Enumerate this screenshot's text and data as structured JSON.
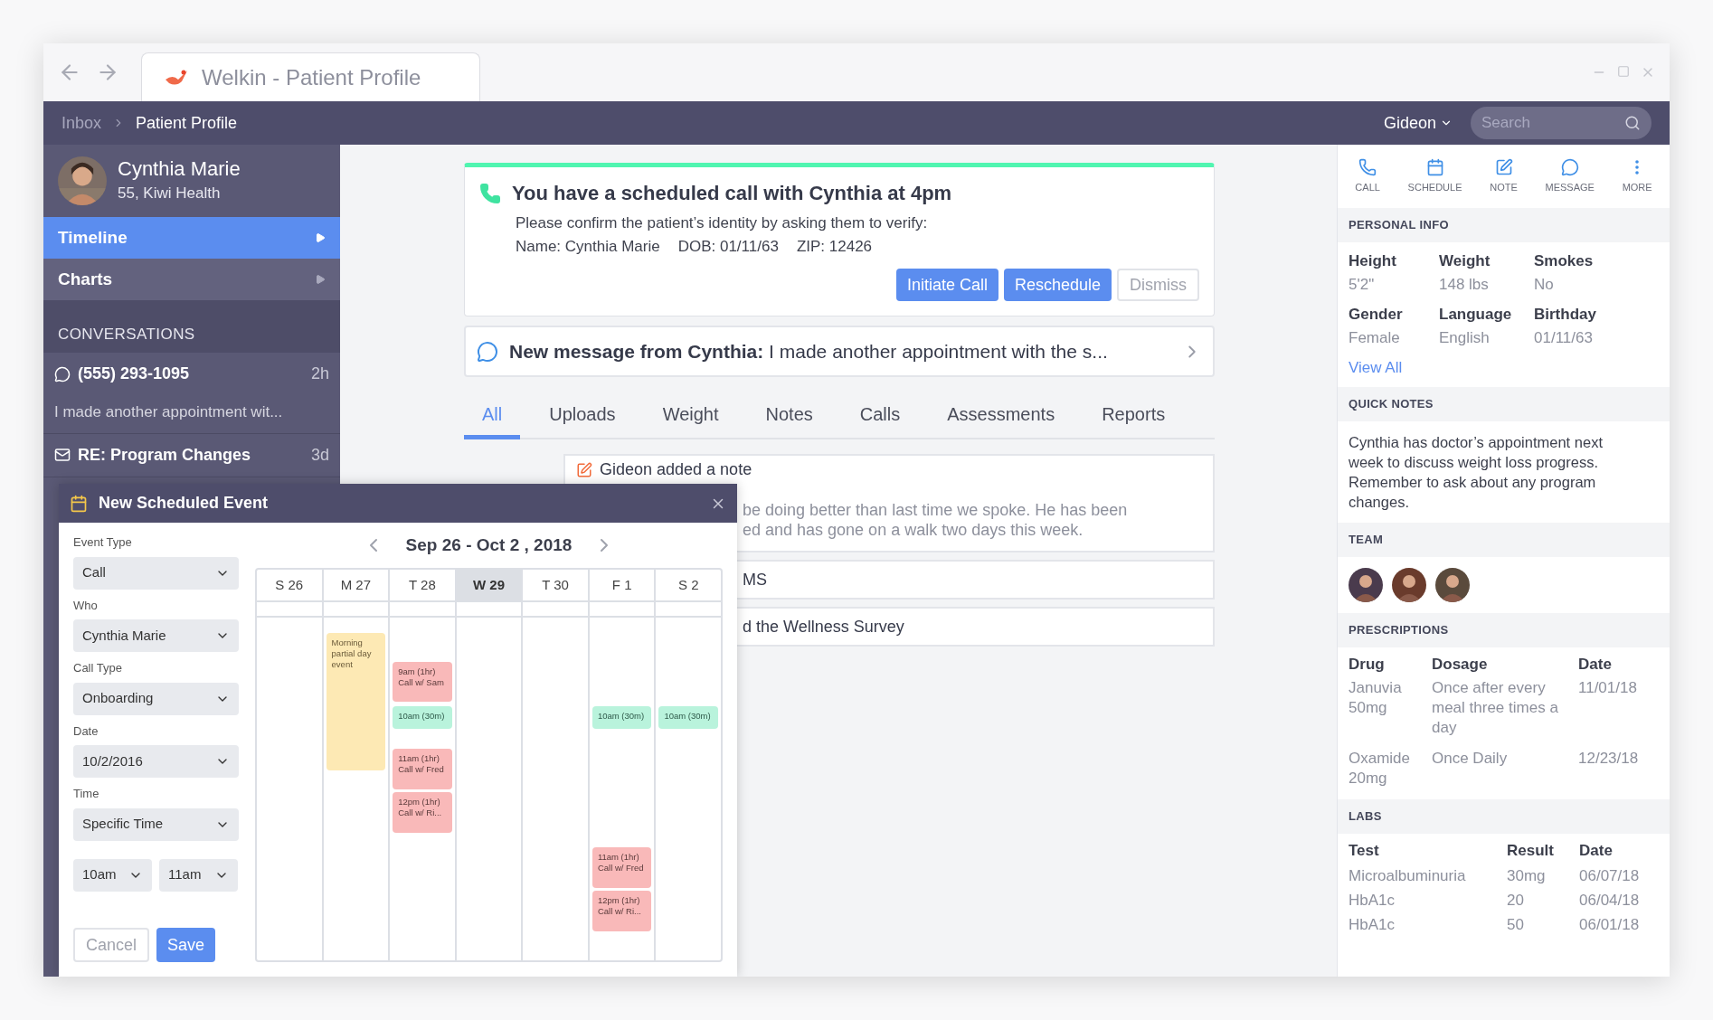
{
  "browser": {
    "tab_title": "Welkin - Patient Profile"
  },
  "breadcrumb": [
    {
      "label": "Inbox",
      "selected": false
    },
    {
      "label": "Patient Profile",
      "selected": true
    }
  ],
  "user_menu": "Gideon",
  "search": {
    "placeholder": "Search"
  },
  "patient": {
    "name": "Cynthia Marie",
    "details": "55, Kiwi Health"
  },
  "nav": [
    {
      "label": "Timeline",
      "selected": true
    },
    {
      "label": "Charts",
      "selected": false
    }
  ],
  "conversations": {
    "title": "CONVERSATIONS",
    "items": [
      {
        "kind": "sms",
        "title": "(555) 293-1095",
        "age": "2h",
        "preview": "I made another appointment wit..."
      },
      {
        "kind": "email",
        "title": "RE: Program Changes",
        "age": "3d"
      }
    ]
  },
  "alert": {
    "title": "You have a scheduled call with Cynthia at 4pm",
    "body": "Please confirm the patient’s identity by asking them to verify:",
    "fields": [
      "Name: Cynthia Marie",
      "DOB: 01/11/63",
      "ZIP: 12426"
    ],
    "buttons": [
      {
        "label": "Initiate Call",
        "kind": "primary"
      },
      {
        "label": "Reschedule",
        "kind": "primary"
      },
      {
        "label": "Dismiss",
        "kind": "secondary"
      }
    ]
  },
  "message": {
    "sender": "New message from Cynthia:",
    "text": "I made another appointment with the s..."
  },
  "tabs": [
    {
      "label": "All",
      "selected": true
    },
    {
      "label": "Uploads",
      "selected": false
    },
    {
      "label": "Weight",
      "selected": false
    },
    {
      "label": "Notes",
      "selected": false
    },
    {
      "label": "Calls",
      "selected": false
    },
    {
      "label": "Assessments",
      "selected": false
    },
    {
      "label": "Reports",
      "selected": false
    }
  ],
  "timeline": [
    {
      "kind": "note",
      "title": "Gideon added a note",
      "lines": [
        "be doing better than last time we spoke. He has been",
        "ed and has gone on a walk two days this week."
      ]
    },
    {
      "kind": "plain",
      "title": "MS"
    },
    {
      "kind": "plain",
      "title": "d the Wellness Survey"
    }
  ],
  "dialog": {
    "title": "New Scheduled Event",
    "fields": [
      {
        "label": "Event Type",
        "value": "Call"
      },
      {
        "label": "Who",
        "value": "Cynthia Marie"
      },
      {
        "label": "Call Type",
        "value": "Onboarding"
      },
      {
        "label": "Date",
        "value": "10/2/2016"
      },
      {
        "label": "Time",
        "value": "Specific Time"
      }
    ],
    "time_range": [
      "10am",
      "11am"
    ],
    "buttons": [
      {
        "label": "Cancel",
        "kind": "secondary"
      },
      {
        "label": "Save",
        "kind": "primary"
      }
    ],
    "week": "Sep 26 - Oct 2 , 2018",
    "days": [
      {
        "label": "S 26",
        "selected": false
      },
      {
        "label": "M 27",
        "selected": false,
        "events": [
          {
            "kind": "partial",
            "lines": [
              "Morning partial day event"
            ]
          }
        ]
      },
      {
        "label": "T 28",
        "selected": false,
        "events": [
          {
            "kind": "booked",
            "lines": [
              "9am (1hr)",
              "Call w/ Sam"
            ]
          },
          {
            "kind": "open",
            "lines": [
              "10am (30m)"
            ]
          },
          {
            "kind": "booked",
            "lines": [
              "11am (1hr)",
              "Call w/ Fred"
            ]
          },
          {
            "kind": "booked",
            "lines": [
              "12pm (1hr)",
              "Call w/ Ri..."
            ]
          }
        ]
      },
      {
        "label": "W 29",
        "selected": true
      },
      {
        "label": "T 30",
        "selected": false
      },
      {
        "label": "F 1",
        "selected": false,
        "events": [
          {
            "kind": "open",
            "lines": [
              "10am (30m)"
            ]
          },
          {
            "kind": "booked",
            "lines": [
              "11am (1hr)",
              "Call w/ Fred"
            ]
          },
          {
            "kind": "booked",
            "lines": [
              "12pm (1hr)",
              "Call w/ Ri..."
            ]
          }
        ]
      },
      {
        "label": "S 2",
        "selected": false,
        "events": [
          {
            "kind": "open",
            "lines": [
              "10am (30m)"
            ]
          }
        ]
      }
    ]
  },
  "actions": [
    {
      "label": "CALL",
      "kind": "call"
    },
    {
      "label": "SCHEDULE",
      "kind": "schedule"
    },
    {
      "label": "NOTE",
      "kind": "note"
    },
    {
      "label": "MESSAGE",
      "kind": "message"
    },
    {
      "label": "MORE",
      "kind": "more"
    }
  ],
  "personal_info": {
    "title": "PERSONAL INFO",
    "fields": [
      {
        "label": "Height",
        "value": "5'2\""
      },
      {
        "label": "Weight",
        "value": "148 lbs"
      },
      {
        "label": "Smokes",
        "value": "No"
      },
      {
        "label": "Gender",
        "value": "Female"
      },
      {
        "label": "Language",
        "value": "English"
      },
      {
        "label": "Birthday",
        "value": "01/11/63"
      }
    ],
    "link": "View All"
  },
  "quick_notes": {
    "title": "QUICK NOTES",
    "text": "Cynthia has doctor’s appointment next week to discuss weight loss progress. Remember to ask about any program changes."
  },
  "team": {
    "title": "TEAM"
  },
  "prescriptions": {
    "title": "PRESCRIPTIONS",
    "columns": [
      "Drug",
      "Dosage",
      "Date"
    ],
    "rows": [
      [
        "Januvia 50mg",
        "Once after every meal three times a day",
        "11/01/18"
      ],
      [
        "Oxamide 20mg",
        "Once Daily",
        "12/23/18"
      ]
    ]
  },
  "labs": {
    "title": "LABS",
    "columns": [
      "Test",
      "Result",
      "Date"
    ],
    "rows": [
      [
        "Microalbuminuria",
        "30mg",
        "06/07/18"
      ],
      [
        "HbA1c",
        "20",
        "06/04/18"
      ],
      [
        "HbA1c",
        "50",
        "06/01/18"
      ]
    ]
  }
}
